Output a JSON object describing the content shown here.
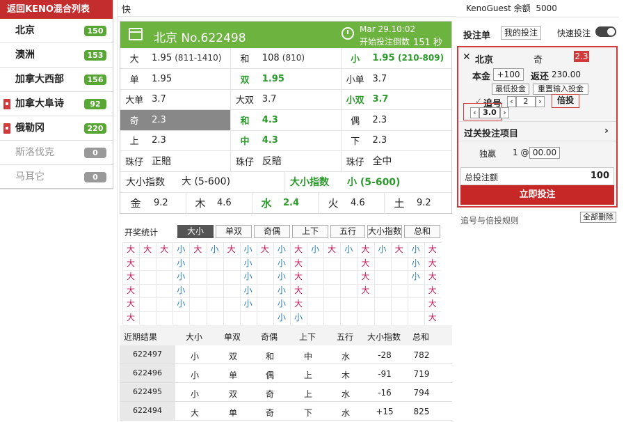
{
  "sidebar": {
    "back_label": "返回KENO混合列表",
    "items": [
      {
        "label": "北京",
        "count": "150"
      },
      {
        "label": "澳洲",
        "count": "153"
      },
      {
        "label": "加拿大西部",
        "count": "156"
      },
      {
        "label": "加拿大阜诗",
        "count": "92"
      },
      {
        "label": "俄勒冈",
        "count": "220"
      },
      {
        "label": "斯洛伐克",
        "count": "0"
      },
      {
        "label": "马耳它",
        "count": "0"
      }
    ]
  },
  "quick_label": "快",
  "game": {
    "title": "北京 No.622498",
    "time": "Mar 29.10:02",
    "countdown_label": "开始投注倒数",
    "countdown_value": "151 秒",
    "rows": {
      "r1": {
        "a_lbl": "大",
        "a_val": "1.95",
        "a_rng": "(811-1410)",
        "b_lbl": "和",
        "b_val": "108",
        "b_rng": "(810)",
        "c_lbl": "小",
        "c_val": "1.95",
        "c_rng": "(210-809)"
      },
      "r2": {
        "a_lbl": "单",
        "a_val": "1.95",
        "b_lbl": "双",
        "b_val": "1.95",
        "c_lbl": "小单",
        "c_val": "3.7"
      },
      "r3": {
        "a_lbl": "大单",
        "a_val": "3.7",
        "b_lbl": "大双",
        "b_val": "3.7",
        "c_lbl": "小双",
        "c_val": "3.7"
      },
      "r4": {
        "a_lbl": "奇",
        "a_val": "2.3",
        "b_lbl": "和",
        "b_val": "4.3",
        "c_lbl": "偶",
        "c_val": "2.3"
      },
      "r5": {
        "a_lbl": "上",
        "a_val": "2.3",
        "b_lbl": "中",
        "b_val": "4.3",
        "c_lbl": "下",
        "c_val": "2.3"
      },
      "r6": {
        "a_lbl": "珠仔",
        "a_val": "正賠",
        "b_lbl": "珠仔",
        "b_val": "反賠",
        "c_lbl": "珠仔",
        "c_val": "全中"
      },
      "r7": {
        "a_lbl": "大小指数",
        "a_val": "大 (5-600)",
        "b_lbl": "大小指数",
        "b_val": "小 (5-600)"
      },
      "r8": {
        "e1_lbl": "金",
        "e1_val": "9.2",
        "e2_lbl": "木",
        "e2_val": "4.6",
        "e3_lbl": "水",
        "e3_val": "2.4",
        "e4_lbl": "火",
        "e4_val": "4.6",
        "e5_lbl": "土",
        "e5_val": "9.2"
      }
    }
  },
  "stats": {
    "label": "开奖统计",
    "tabs": [
      "大小",
      "单双",
      "奇偶",
      "上下",
      "五行",
      "大小指数",
      "总和"
    ],
    "active_tab": "大小",
    "grid_columns": [
      [
        "大",
        "大",
        "大",
        "大",
        "大",
        "大"
      ],
      [
        "大"
      ],
      [
        "大"
      ],
      [
        "小",
        "小",
        "小",
        "小",
        "小"
      ],
      [
        "大"
      ],
      [
        "小"
      ],
      [
        "大"
      ],
      [
        "小",
        "小",
        "小",
        "小",
        "小"
      ],
      [
        "大"
      ],
      [
        "小",
        "小",
        "小",
        "小",
        "小",
        "小"
      ],
      [
        "大",
        "大",
        "大",
        "大",
        "大",
        "小"
      ],
      [
        "小"
      ],
      [
        "大"
      ],
      [
        "小"
      ],
      [
        "大",
        "大",
        "大",
        "大"
      ],
      [
        "小"
      ],
      [
        "大"
      ],
      [
        "小",
        "小",
        "小"
      ],
      [
        "大",
        "大",
        "大",
        "大",
        "大",
        "大"
      ]
    ]
  },
  "recent": {
    "label": "近期结果",
    "headers": [
      "大小",
      "单双",
      "奇偶",
      "上下",
      "五行",
      "大小指数",
      "总和"
    ],
    "rows": [
      {
        "id": "622497",
        "vals": [
          "小",
          "双",
          "和",
          "中",
          "水",
          "-28",
          "782"
        ]
      },
      {
        "id": "622496",
        "vals": [
          "小",
          "单",
          "偶",
          "上",
          "木",
          "-91",
          "719"
        ]
      },
      {
        "id": "622495",
        "vals": [
          "小",
          "双",
          "奇",
          "上",
          "水",
          "-16",
          "794"
        ]
      },
      {
        "id": "622494",
        "vals": [
          "大",
          "单",
          "奇",
          "下",
          "水",
          "+15",
          "825"
        ]
      }
    ]
  },
  "account": {
    "user": "KenoGuest 余额",
    "balance": "5000"
  },
  "slip": {
    "title": "投注单",
    "my_bets": "我的投注",
    "fast_bet": "快速投注",
    "city": "北京",
    "pick": "奇",
    "odd": "2.3",
    "stake_label": "本金",
    "stake_btn": "+100",
    "return_label": "返还",
    "return_val": "230.00",
    "min_stake": "最低投金",
    "reenter": "重置输入投金",
    "chase_label": "追号",
    "chase_val": "2",
    "multiply_btn": "倍投",
    "multiply_val": "3.0",
    "parlay_label": "过关投注项目",
    "single_label": "独赢",
    "single_mult": "1 @",
    "single_val": "00.00",
    "total_label": "总投注额",
    "total_val": "100",
    "submit": "立即投注"
  },
  "rules_link": "追号与倍投规则",
  "clear_all": "全部删除"
}
